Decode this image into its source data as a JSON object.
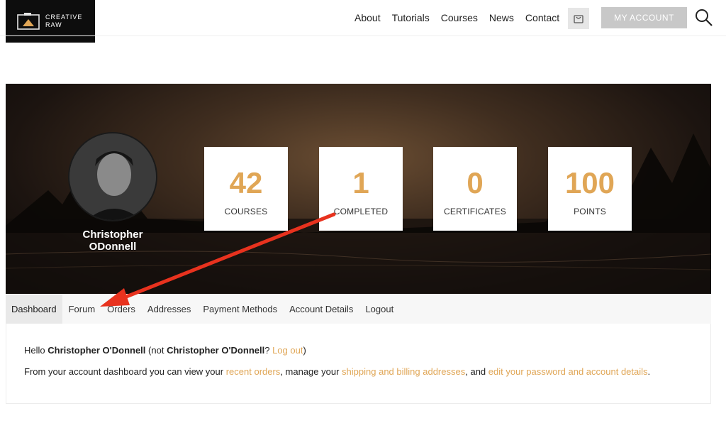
{
  "header": {
    "logo_line1": "CREATIVE",
    "logo_line2": "RAW",
    "nav": [
      "About",
      "Tutorials",
      "Courses",
      "News",
      "Contact"
    ],
    "account_button": "MY ACCOUNT"
  },
  "profile": {
    "name": "Christopher ODonnell",
    "stats": [
      {
        "value": "42",
        "label": "COURSES"
      },
      {
        "value": "1",
        "label": "COMPLETED"
      },
      {
        "value": "0",
        "label": "CERTIFICATES"
      },
      {
        "value": "100",
        "label": "POINTS"
      }
    ]
  },
  "tabs": [
    "Dashboard",
    "Forum",
    "Orders",
    "Addresses",
    "Payment Methods",
    "Account Details",
    "Logout"
  ],
  "active_tab": "Dashboard",
  "content": {
    "hello": "Hello",
    "user_bold": "Christopher O'Donnell",
    "not_prefix": "(not",
    "not_user_bold": "Christopher O'Donnell",
    "question": "?",
    "logout_link": "Log out",
    "close_paren": ")",
    "desc_start": "From your account dashboard you can view your",
    "recent_orders_link": "recent orders",
    "desc_mid1": ", manage your",
    "addresses_link": "shipping and billing addresses",
    "desc_mid2": ", and",
    "password_link": "edit your password and account details",
    "desc_end": "."
  },
  "colors": {
    "accent": "#e0a656",
    "annotation_arrow": "#e8321e"
  },
  "icons": {
    "cart": "shopping-bag-icon",
    "search": "search-icon"
  }
}
